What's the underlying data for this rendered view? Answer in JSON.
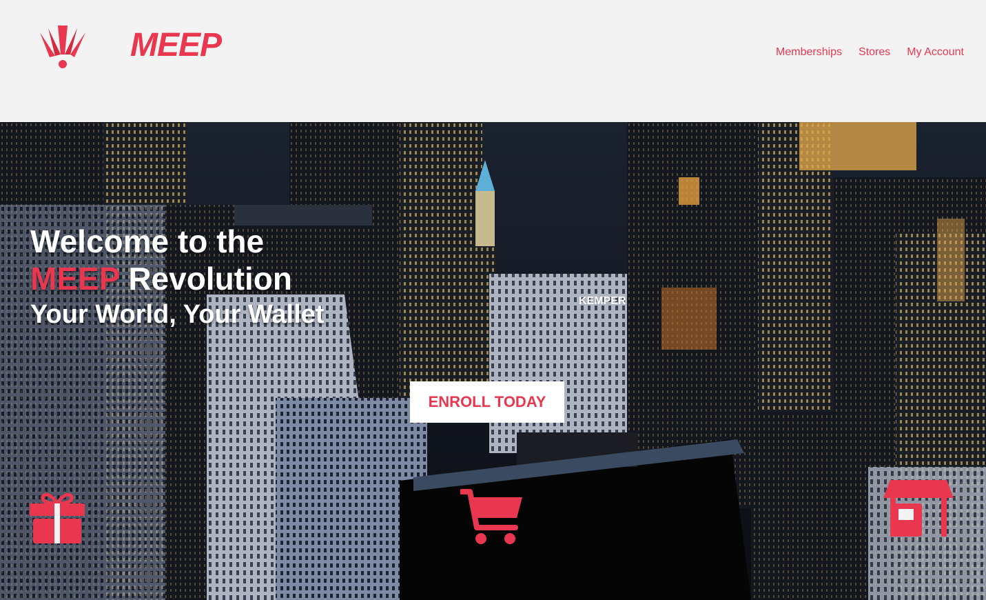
{
  "brand": {
    "name": "MEEP",
    "logo_icon": "meep-alert-logo-icon"
  },
  "nav": {
    "items": [
      "Memberships",
      "Stores",
      "My Account"
    ]
  },
  "hero": {
    "title_line1": "Welcome to the",
    "title_accent": "MEEP",
    "title_rest": " Revolution",
    "subtitle": "Your World, Your Wallet",
    "cta": "ENROLL TODAY",
    "sign_text": "KEMPER",
    "background": "night-city-skyline-image"
  },
  "features": {
    "icons": [
      "gift-icon",
      "shopping-cart-icon",
      "store-icon"
    ]
  },
  "colors": {
    "accent": "#e8374f",
    "header_bg": "#f3f3f3",
    "text_on_dark": "#ffffff"
  }
}
